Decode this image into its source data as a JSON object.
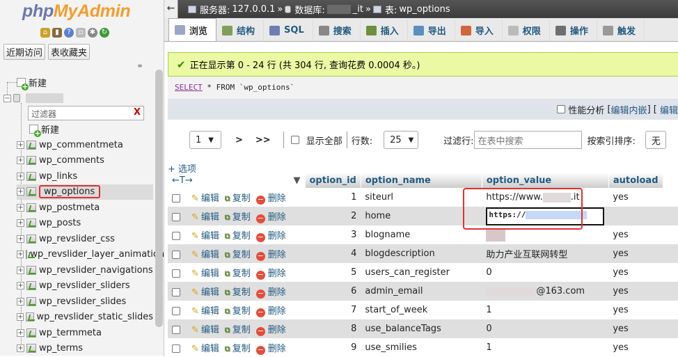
{
  "nav": {
    "logo_php": "php",
    "logo_my": "My",
    "logo_admin": "Admin",
    "tab_recent": "近期访问",
    "tab_favorites": "表收藏夹",
    "new_label": "新建",
    "db_name": "",
    "filter_placeholder": "过滤器",
    "filter_clear": "X",
    "new_table_label": "新建",
    "tables": [
      "wp_commentmeta",
      "wp_comments",
      "wp_links",
      "wp_options",
      "wp_postmeta",
      "wp_posts",
      "wp_revslider_css",
      "wp_revslider_layer_animations",
      "wp_revslider_navigations",
      "wp_revslider_sliders",
      "wp_revslider_slides",
      "wp_revslider_static_slides",
      "wp_termmeta",
      "wp_terms"
    ],
    "selected_table": "wp_options"
  },
  "breadcrumb": {
    "server_label": "服务器:",
    "server_value": "127.0.0.1",
    "db_label": "数据库:",
    "db_suffix": "_it",
    "table_label": "表:",
    "table_value": "wp_options"
  },
  "tabs": [
    "浏览",
    "结构",
    "SQL",
    "搜索",
    "插入",
    "导出",
    "导入",
    "权限",
    "操作",
    "触发"
  ],
  "message": "正在显示第 0 - 24 行 (共 304 行, 查询花费 0.0004 秒。)",
  "sql": {
    "keyword_select": "SELECT",
    "rest": " * FROM `wp_options`"
  },
  "profiling": {
    "label": "性能分析",
    "open": "[",
    "edit_inline": "编辑内嵌",
    "mid": "] [",
    "edit": "编辑"
  },
  "navigation": {
    "page_value": "1",
    "next": ">",
    "last": ">>",
    "show_all": "显示全部",
    "rows_label": "行数:",
    "rows_value": "25",
    "filter_label": "过滤行:",
    "filter_placeholder": "在表中搜索",
    "sort_label": "按索引排序:",
    "sort_value": "无"
  },
  "options_link": "+ 选项",
  "columns": {
    "option_id": "option_id",
    "option_name": "option_name",
    "option_value": "option_value",
    "autoload": "autoload"
  },
  "actions": {
    "edit": "编辑",
    "copy": "复制",
    "delete": "删除"
  },
  "rows": [
    {
      "id": "1",
      "name": "siteurl",
      "value_prefix": "https://www.",
      "value_suffix": ".it",
      "autoload": "yes"
    },
    {
      "id": "2",
      "name": "home",
      "value_prefix": "https://",
      "value_suffix": "",
      "autoload": ""
    },
    {
      "id": "3",
      "name": "blogname",
      "value_prefix": "",
      "value_suffix": "",
      "autoload": "yes"
    },
    {
      "id": "4",
      "name": "blogdescription",
      "value_prefix": "助力产业互联网转型",
      "value_suffix": "",
      "autoload": "yes"
    },
    {
      "id": "5",
      "name": "users_can_register",
      "value_prefix": "0",
      "value_suffix": "",
      "autoload": "yes"
    },
    {
      "id": "6",
      "name": "admin_email",
      "value_prefix": "",
      "value_suffix": "@163.com",
      "autoload": "yes"
    },
    {
      "id": "7",
      "name": "start_of_week",
      "value_prefix": "1",
      "value_suffix": "",
      "autoload": "yes"
    },
    {
      "id": "8",
      "name": "use_balanceTags",
      "value_prefix": "0",
      "value_suffix": "",
      "autoload": "yes"
    },
    {
      "id": "9",
      "name": "use_smilies",
      "value_prefix": "1",
      "value_suffix": "",
      "autoload": "yes"
    }
  ]
}
